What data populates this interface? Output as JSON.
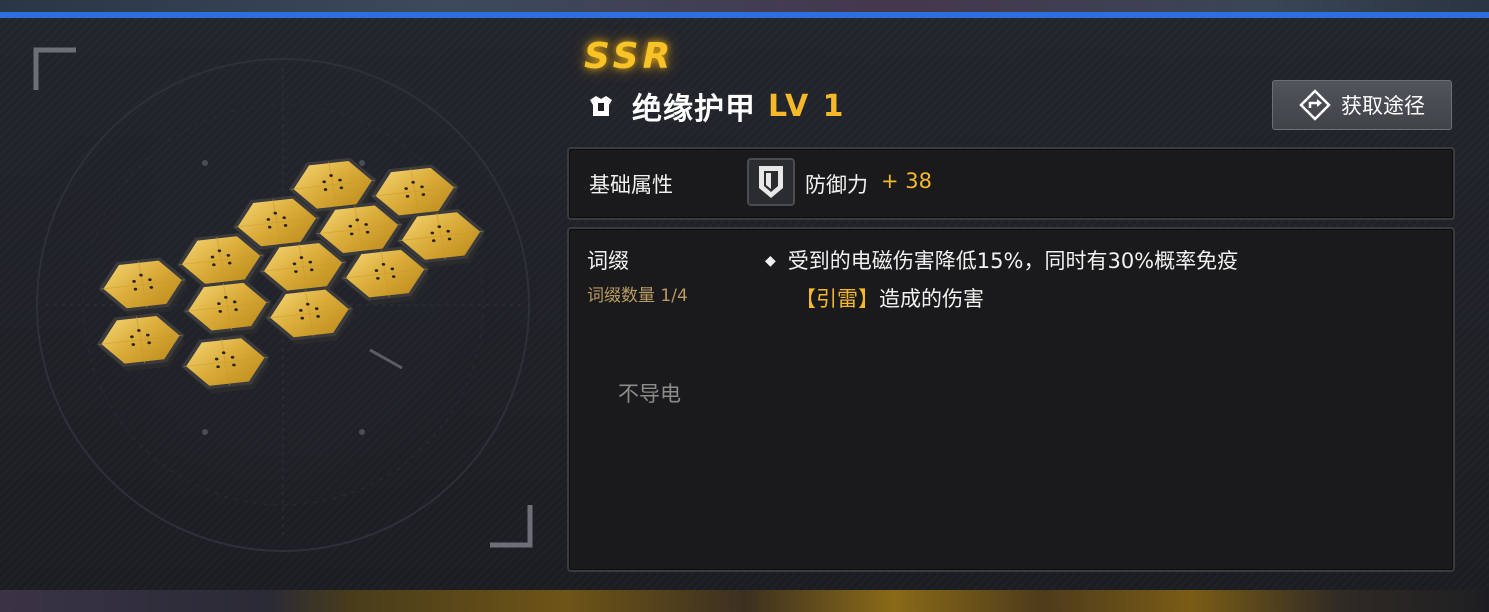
{
  "item": {
    "rarity": "SSR",
    "name": "绝缘护甲",
    "level": "LV 1",
    "type_icon": "armor-icon"
  },
  "actions": {
    "obtain_label": "获取途径",
    "obtain_icon": "route-diamond-icon"
  },
  "base_stats": {
    "label": "基础属性",
    "stat_icon": "shield-icon",
    "stat_name": "防御力",
    "stat_value": "+ 38"
  },
  "affixes": {
    "label": "词缀",
    "count_text": "词缀数量 1/4",
    "entries": [
      {
        "line1": "受到的电磁伤害降低15%，同时有30%概率免疫",
        "keyword": "【引雷】",
        "line2_rest": "造成的伤害"
      }
    ]
  },
  "trait": "不导电",
  "colors": {
    "accent_blue": "#2e6fe0",
    "rarity_gold": "#f7c326",
    "value_gold": "#f5b82a",
    "affix_count": "#b99a62"
  }
}
